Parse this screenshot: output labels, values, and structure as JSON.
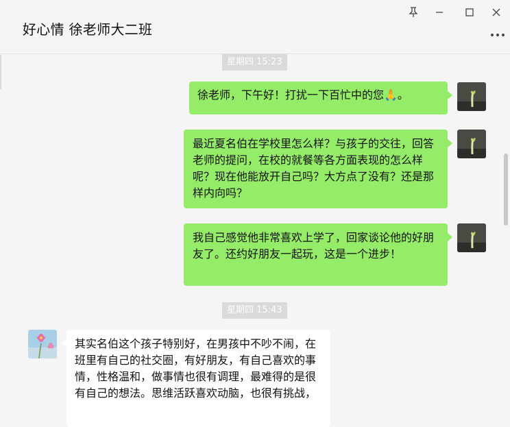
{
  "window": {
    "title": "好心情 徐老师大二班",
    "buttons": [
      "pin-icon",
      "minimize-icon",
      "maximize-icon",
      "close-icon"
    ],
    "more_icon": "more-options-icon"
  },
  "messages": [
    {
      "type": "timestamp",
      "text": "星期四 15:23"
    },
    {
      "type": "message",
      "sender": "me",
      "text": "徐老师，下午好！打扰一下百忙中的您🙏。",
      "avatar": "seedling-avatar"
    },
    {
      "type": "message",
      "sender": "me",
      "text": "最近夏名伯在学校里怎么样？与孩子的交往，回答老师的提问，在校的就餐等各方面表现的怎么样呢？现在他能放开自己吗？大方点了没有？还是那样内向吗？",
      "avatar": "seedling-avatar"
    },
    {
      "type": "message",
      "sender": "me",
      "text": "我自己感觉他非常喜欢上学了，回家谈论他的好朋友了。还约好朋友一起玩，这是一个进步！",
      "avatar": "seedling-avatar"
    },
    {
      "type": "timestamp",
      "text": "星期四 15:43"
    },
    {
      "type": "message",
      "sender": "other",
      "text": "其实名伯这个孩子特别好，在男孩中不吵不闹，在班里有自己的社交圈，有好朋友，有自己喜欢的事情，性格温和，做事情也很有调理，最难得的是很有自己的想法。思维活跃喜欢动脑，也很有挑战，",
      "avatar": "pink-flower-avatar"
    }
  ],
  "colors": {
    "my_bubble": "#95ec69",
    "other_bubble": "#ffffff",
    "background": "#f5f5f5",
    "timestamp_bg": "#dadada"
  }
}
